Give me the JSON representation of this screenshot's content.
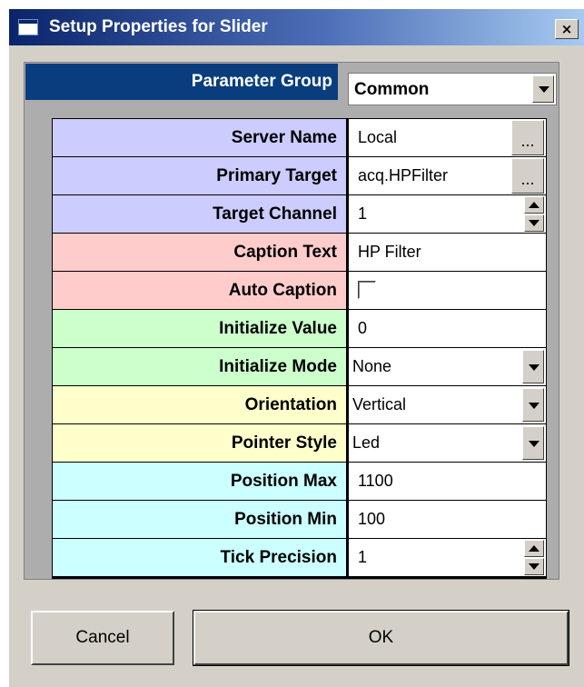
{
  "window": {
    "title": "Setup Properties for Slider",
    "icon": "window-icon",
    "close_label": "×"
  },
  "group": {
    "label": "Parameter Group",
    "value": "Common"
  },
  "rows": [
    {
      "label": "Server Name",
      "value": "Local",
      "control": "browse",
      "button_label": "...",
      "color": "#ccccff"
    },
    {
      "label": "Primary Target",
      "value": "acq.HPFilter",
      "control": "browse",
      "button_label": "...",
      "color": "#ccccff"
    },
    {
      "label": "Target Channel",
      "value": "1",
      "control": "spin",
      "color": "#ccccff"
    },
    {
      "label": "Caption Text",
      "value": "HP Filter",
      "control": "text",
      "color": "#ffcccc"
    },
    {
      "label": "Auto Caption",
      "value": "",
      "checked": false,
      "control": "checkbox",
      "color": "#ffcccc"
    },
    {
      "label": "Initialize Value",
      "value": "0",
      "control": "text",
      "color": "#ccffcc"
    },
    {
      "label": "Initialize Mode",
      "value": "None",
      "control": "select",
      "color": "#ccffcc"
    },
    {
      "label": "Orientation",
      "value": "Vertical",
      "control": "select",
      "color": "#ffffcc"
    },
    {
      "label": "Pointer Style",
      "value": "Led",
      "control": "select",
      "color": "#ffffcc"
    },
    {
      "label": "Position Max",
      "value": "1100",
      "control": "text",
      "color": "#ccffff"
    },
    {
      "label": "Position Min",
      "value": "100",
      "control": "text",
      "color": "#ccffff"
    },
    {
      "label": "Tick Precision",
      "value": "1",
      "control": "spin",
      "color": "#ccffff"
    }
  ],
  "buttons": {
    "cancel": "Cancel",
    "ok": "OK"
  }
}
